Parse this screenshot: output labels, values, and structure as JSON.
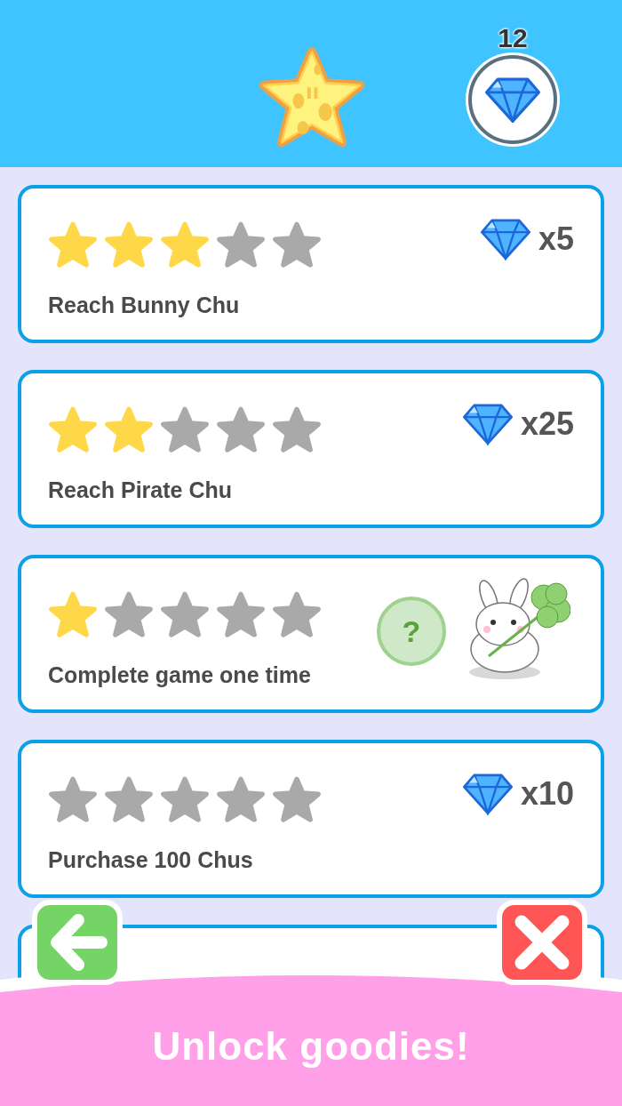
{
  "header": {
    "gem_count": "12"
  },
  "cards": [
    {
      "kind": "gems",
      "stars": 3,
      "title": "Reach Bunny Chu",
      "reward": "x5"
    },
    {
      "kind": "gems",
      "stars": 2,
      "title": "Reach Pirate Chu",
      "reward": "x25"
    },
    {
      "kind": "mystery",
      "stars": 1,
      "title": "Complete game one time",
      "reward_label": "?"
    },
    {
      "kind": "gems",
      "stars": 0,
      "title": "Purchase 100 Chus",
      "reward": "x10"
    }
  ],
  "banner": {
    "text": "Unlock goodies!"
  }
}
